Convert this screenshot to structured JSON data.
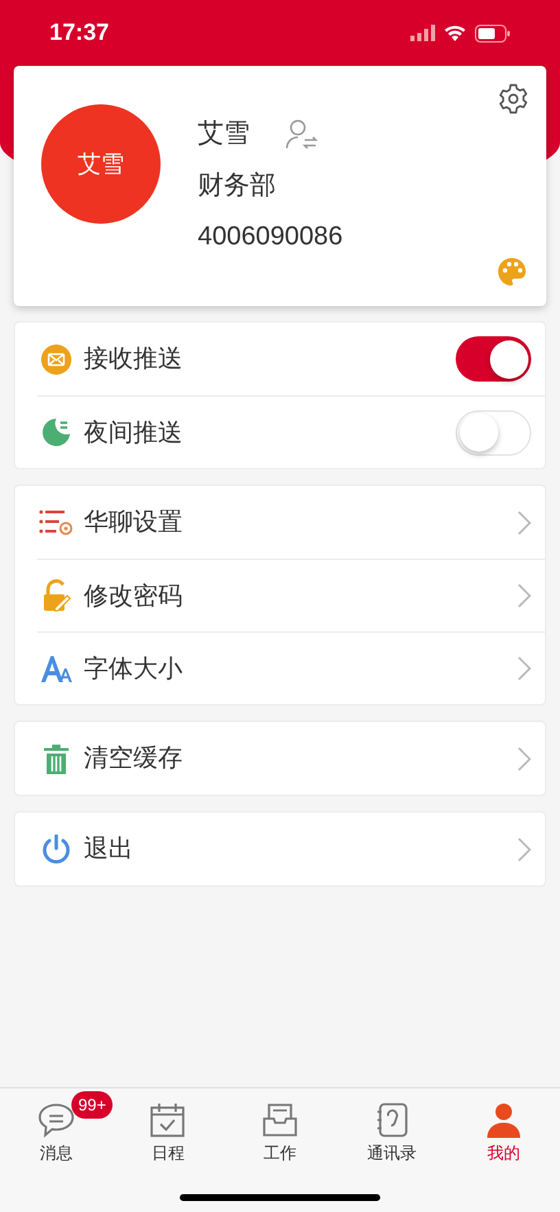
{
  "status_bar": {
    "time": "17:37"
  },
  "profile": {
    "avatar_text": "艾雪",
    "name": "艾雪",
    "department": "财务部",
    "phone": "4006090086"
  },
  "groups": [
    {
      "items": [
        {
          "kind": "toggle",
          "label": "接收推送",
          "on": true
        },
        {
          "kind": "toggle",
          "label": "夜间推送",
          "on": false
        }
      ]
    },
    {
      "items": [
        {
          "kind": "link",
          "label": "华聊设置"
        },
        {
          "kind": "link",
          "label": "修改密码"
        },
        {
          "kind": "link",
          "label": "字体大小"
        }
      ]
    },
    {
      "items": [
        {
          "kind": "link",
          "label": "清空缓存"
        }
      ]
    },
    {
      "items": [
        {
          "kind": "link",
          "label": "退出"
        }
      ]
    }
  ],
  "tabs": [
    {
      "label": "消息",
      "selected": false,
      "badge": "99+"
    },
    {
      "label": "日程",
      "selected": false
    },
    {
      "label": "工作",
      "selected": false
    },
    {
      "label": "通讯录",
      "selected": false
    },
    {
      "label": "我的",
      "selected": true
    }
  ]
}
